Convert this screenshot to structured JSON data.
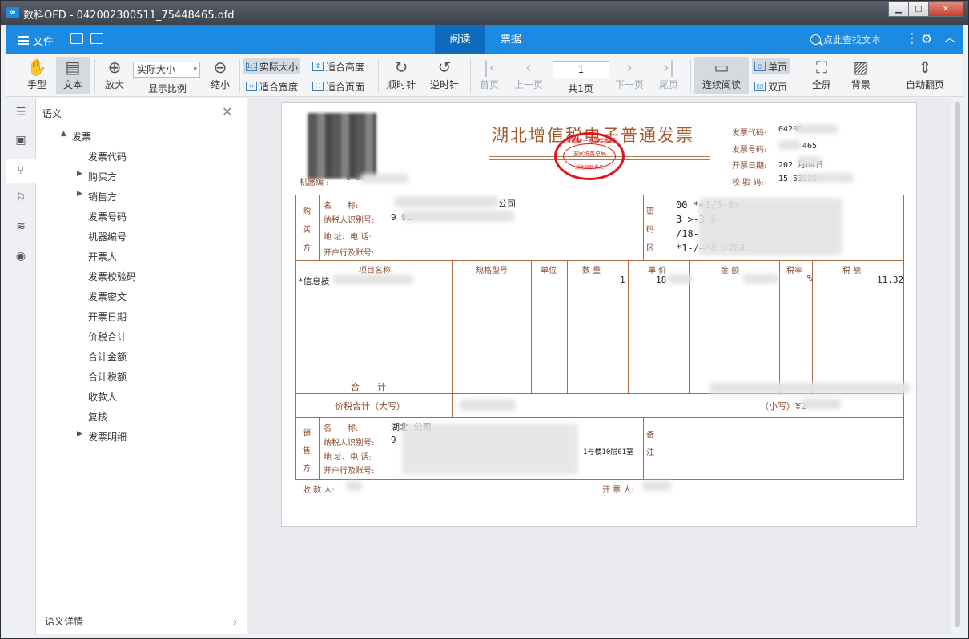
{
  "window": {
    "title": "数科OFD - 042002300511_75448465.ofd",
    "logo": "∞"
  },
  "appbar": {
    "menu_label": "文件",
    "tabs": [
      "阅读",
      "票据"
    ],
    "search_placeholder": "点此查找文本"
  },
  "toolbar": {
    "hand": "手型",
    "text": "文本",
    "zoom_in": "放大",
    "zoom_select": "实际大小",
    "zoom_label": "显示比例",
    "zoom_out": "缩小",
    "actual_size": "实际大小",
    "fit_height": "适合高度",
    "fit_width": "适合宽度",
    "fit_page": "适合页面",
    "rotate_cw": "顺时针",
    "rotate_ccw": "逆时针",
    "first": "首页",
    "prev": "上一页",
    "page_value": "1",
    "total": "共1页",
    "next": "下一页",
    "last": "尾页",
    "continuous": "连续阅读",
    "single": "单页",
    "double": "双页",
    "fullscreen": "全屏",
    "background": "背景",
    "auto_flip": "自动翻页"
  },
  "panel": {
    "header": "语义",
    "footer": "语义详情",
    "tree": [
      {
        "label": "发票",
        "level": 0,
        "toggle": "▲"
      },
      {
        "label": "发票代码",
        "level": 2,
        "toggle": ""
      },
      {
        "label": "购买方",
        "level": 1,
        "toggle": "▶"
      },
      {
        "label": "销售方",
        "level": 1,
        "toggle": "▶"
      },
      {
        "label": "发票号码",
        "level": 2,
        "toggle": ""
      },
      {
        "label": "机器编号",
        "level": 2,
        "toggle": ""
      },
      {
        "label": "开票人",
        "level": 2,
        "toggle": ""
      },
      {
        "label": "发票校验码",
        "level": 2,
        "toggle": ""
      },
      {
        "label": "发票密文",
        "level": 2,
        "toggle": ""
      },
      {
        "label": "开票日期",
        "level": 2,
        "toggle": ""
      },
      {
        "label": "价税合计",
        "level": 2,
        "toggle": ""
      },
      {
        "label": "合计金额",
        "level": 2,
        "toggle": ""
      },
      {
        "label": "合计税额",
        "level": 2,
        "toggle": ""
      },
      {
        "label": "收款人",
        "level": 2,
        "toggle": ""
      },
      {
        "label": "复核",
        "level": 2,
        "toggle": ""
      },
      {
        "label": "发票明细",
        "level": 1,
        "toggle": "▶"
      }
    ]
  },
  "invoice": {
    "title": "湖北增值税电子普通发票",
    "stamp_top": "全国统一发票监制章",
    "stamp_mid": "国家税务总局",
    "stamp_bot": "湖北省税务局",
    "code_label": "发票代码:",
    "code_value": "04200",
    "number_label": "发票号码:",
    "number_value": "465",
    "date_label": "开票日期:",
    "date_value": "202  月04日",
    "check_label": "校 验 码:",
    "check_value": "15   53538",
    "machine_label": "机器编 :",
    "machine_value": "8  60",
    "buyer_side": "购买方",
    "buyer_labels": [
      "名　　称:",
      "纳税人识别号:",
      "地 址、电 话:",
      "开户行及账号:"
    ],
    "buyer_name": "公司",
    "buyer_taxid": "9    9L",
    "cipher_side": "密码区",
    "cipher_lines": [
      "00    *<1/5-9>",
      "3 >-3    6",
      "    /18-",
      "*1-/+*8     >704"
    ],
    "item_headers": [
      "项目名称",
      "规格型号",
      "单位",
      "数 量",
      "单 价",
      "金 额",
      "税率",
      "税 额"
    ],
    "item_name": "*信息技",
    "item_qty": "1",
    "item_price": "18",
    "item_rate": "%",
    "item_tax": "11.32",
    "total_label": "合　　计",
    "sum_label": "价税合计（大写）",
    "sum_small": "（小写）¥2",
    "seller_side": "销售方",
    "seller_labels": [
      "名　　称:",
      "纳税人识别号:",
      "地 址、电 话:",
      "开户行及账号:"
    ],
    "seller_name": "湖北   公司",
    "seller_taxid": "9",
    "seller_addr": "1号楼10层01室",
    "note_side": "备注",
    "payee": "收 款 人:",
    "issuer": "开 票 人:"
  }
}
